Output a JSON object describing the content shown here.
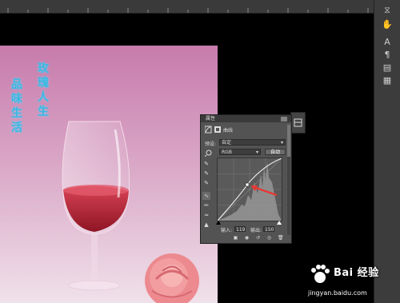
{
  "document": {
    "text_vertical_1": [
      "玫",
      "瑰",
      "人",
      "生"
    ],
    "text_vertical_2": [
      "品",
      "味",
      "生",
      "活"
    ]
  },
  "panel": {
    "title": "属性",
    "header_label": "曲线",
    "preset_label": "预设:",
    "preset_value": "自定",
    "channel_value": "RGB",
    "auto_button": "自动",
    "input_label": "输入:",
    "input_value": "119",
    "output_label": "输出:",
    "output_value": "150"
  },
  "watermark": {
    "brand": "Bai  经验",
    "url": "jingyan.baidu.com"
  },
  "colors": {
    "accent_text": "#3cb7e0",
    "arrow": "#e53935",
    "wine": "#c2283a"
  },
  "icons": {
    "toolbar": [
      "history-icon",
      "hand-icon",
      "character-icon",
      "paragraph-icon",
      "layers-icon",
      "properties-icon"
    ]
  }
}
